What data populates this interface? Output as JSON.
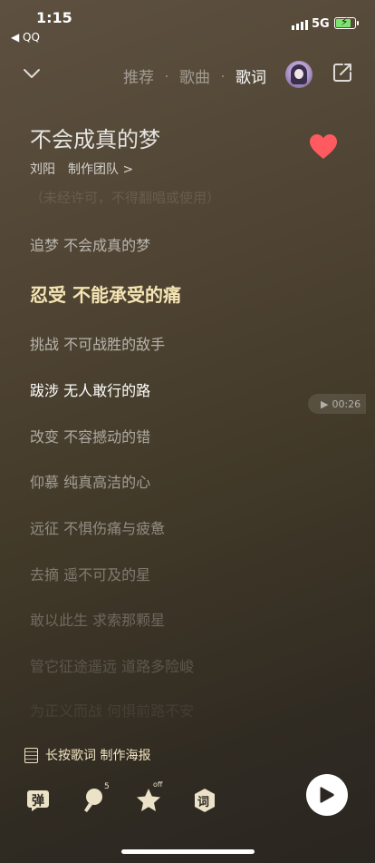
{
  "status": {
    "time": "1:15",
    "back_app": "◀ QQ",
    "network": "5G"
  },
  "nav": {
    "tabs": [
      "推荐",
      "歌曲",
      "歌词"
    ],
    "active_tab": "歌词"
  },
  "song": {
    "title": "不会成真的梦",
    "artist": "刘阳",
    "team": "制作团队 >"
  },
  "lyrics": {
    "hint": "（未经许可，不得翻唱或使用）",
    "lines": [
      "追梦 不会成真的梦",
      "忍受 不能承受的痛",
      "挑战 不可战胜的敌手",
      "跋涉 无人敢行的路",
      "改变 不容撼动的错",
      "仰慕 纯真高洁的心",
      "远征 不惧伤痛与疲惫",
      "去摘 遥不可及的星",
      "敢以此生 求索那颗星",
      "管它征途遥远 道路多险峻",
      "为正义而战 何惧前路不安"
    ],
    "current_index": 1
  },
  "seek": {
    "time": "00:26"
  },
  "poster_label": "长按歌词 制作海报",
  "toolbar": {
    "danmu": "弹",
    "comment_count": "5",
    "star_badge": "off",
    "lyric_label": "词"
  },
  "colors": {
    "current_lyric": "#f5e5b4",
    "heart": "#ff5a5f",
    "battery": "#7ee36f"
  }
}
